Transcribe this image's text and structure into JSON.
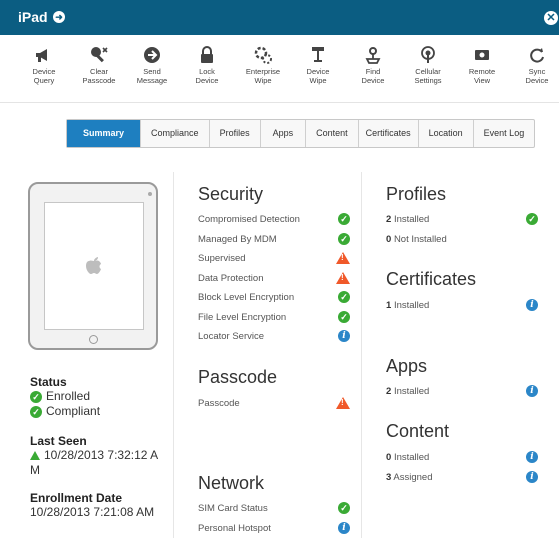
{
  "window": {
    "title": "iPad"
  },
  "toolbar": [
    {
      "id": "device-query",
      "label1": "Device",
      "label2": "Query",
      "icon": "megaphone-icon"
    },
    {
      "id": "clear-passcode",
      "label1": "Clear",
      "label2": "Passcode",
      "icon": "key-clear-icon"
    },
    {
      "id": "send-message",
      "label1": "Send",
      "label2": "Message",
      "icon": "send-arrow-icon"
    },
    {
      "id": "lock-device",
      "label1": "Lock",
      "label2": "Device",
      "icon": "lock-icon"
    },
    {
      "id": "enterprise-wipe",
      "label1": "Enterprise",
      "label2": "Wipe",
      "icon": "enterprise-wipe-icon"
    },
    {
      "id": "device-wipe",
      "label1": "Device",
      "label2": "Wipe",
      "icon": "wipe-icon"
    },
    {
      "id": "find-device",
      "label1": "Find",
      "label2": "Device",
      "icon": "find-icon"
    },
    {
      "id": "cellular-settings",
      "label1": "Cellular",
      "label2": "Settings",
      "icon": "cellular-icon"
    },
    {
      "id": "remote-view",
      "label1": "Remote",
      "label2": "View",
      "icon": "remote-view-icon"
    },
    {
      "id": "sync-device",
      "label1": "Sync",
      "label2": "Device",
      "icon": "sync-icon"
    }
  ],
  "tabs": [
    "Summary",
    "Compliance",
    "Profiles",
    "Apps",
    "Content",
    "Certificates",
    "Location",
    "Event Log"
  ],
  "active_tab": "Summary",
  "left": {
    "status_label": "Status",
    "status_enrolled": "Enrolled",
    "status_compliant": "Compliant",
    "last_seen_label": "Last Seen",
    "last_seen_line1": "10/28/2013 7:32:12 A",
    "last_seen_line2": "M",
    "enrollment_label": "Enrollment Date",
    "enrollment_value": "10/28/2013 7:21:08 AM"
  },
  "security": {
    "title": "Security",
    "items": [
      {
        "label": "Compromised Detection",
        "status": "ok"
      },
      {
        "label": "Managed By MDM",
        "status": "ok"
      },
      {
        "label": "Supervised",
        "status": "warn"
      },
      {
        "label": "Data Protection",
        "status": "warn"
      },
      {
        "label": "Block Level Encryption",
        "status": "ok"
      },
      {
        "label": "File Level Encryption",
        "status": "ok"
      },
      {
        "label": "Locator Service",
        "status": "info"
      }
    ]
  },
  "passcode": {
    "title": "Passcode",
    "items": [
      {
        "label": "Passcode",
        "status": "warn"
      }
    ]
  },
  "network": {
    "title": "Network",
    "items": [
      {
        "label": "SIM Card Status",
        "status": "ok"
      },
      {
        "label": "Personal Hotspot",
        "status": "info"
      }
    ]
  },
  "profiles": {
    "title": "Profiles",
    "installed_count": "2",
    "installed_label": "Installed",
    "not_installed_count": "0",
    "not_installed_label": "Not Installed"
  },
  "certificates": {
    "title": "Certificates",
    "installed_count": "1",
    "installed_label": "Installed"
  },
  "apps": {
    "title": "Apps",
    "installed_count": "2",
    "installed_label": "Installed"
  },
  "content": {
    "title": "Content",
    "installed_count": "0",
    "installed_label": "Installed",
    "assigned_count": "3",
    "assigned_label": "Assigned"
  },
  "colors": {
    "titlebar": "#0b5d82",
    "active_tab": "#1e7fc0",
    "ok": "#3aaa35",
    "warn": "#f0592a",
    "info": "#2b86c8"
  }
}
